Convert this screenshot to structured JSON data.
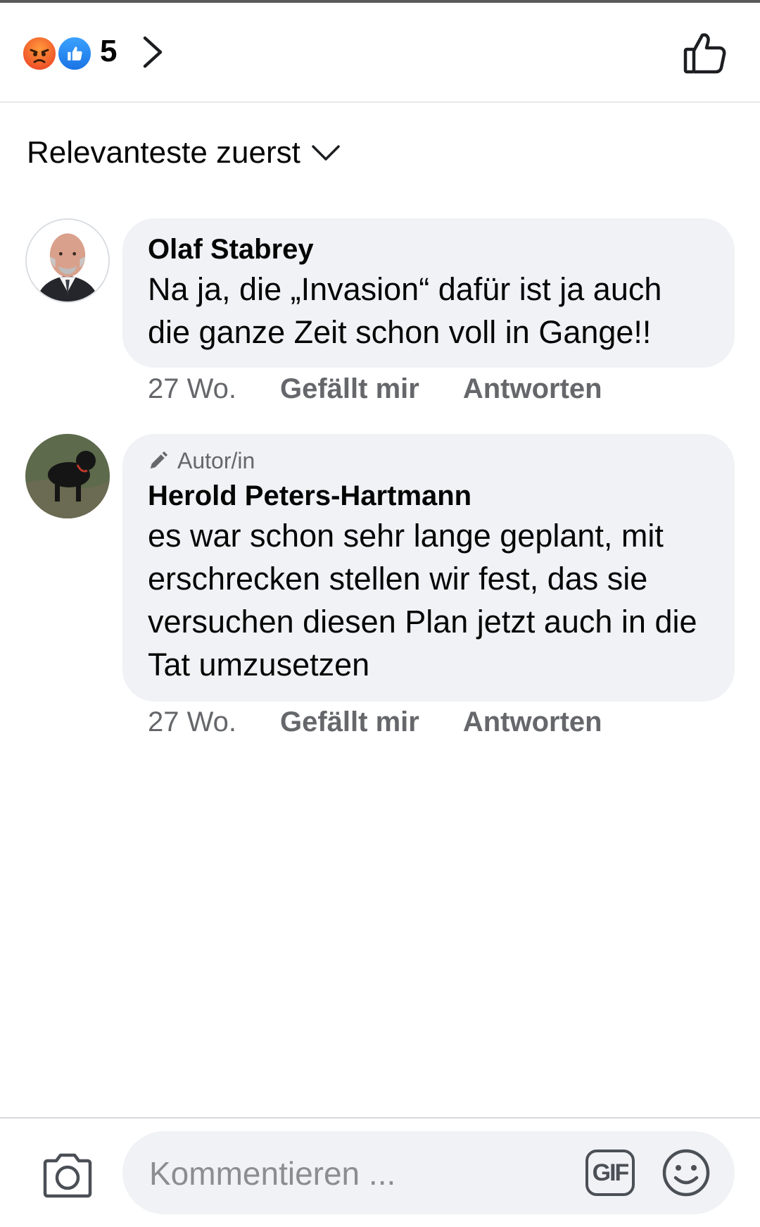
{
  "header": {
    "reactions": [
      "angry-reaction",
      "like-reaction"
    ],
    "reaction_count": "5"
  },
  "sort": {
    "label": "Relevanteste zuerst"
  },
  "comments": [
    {
      "author": "Olaf Stabrey",
      "text": "Na ja, die „Invasion“ dafür ist ja auch die ganze Zeit schon voll in Gange!!",
      "time": "27 Wo.",
      "like_label": "Gefällt mir",
      "reply_label": "Antworten"
    },
    {
      "badge": "Autor/in",
      "author": "Herold Peters-Hartmann",
      "text": "es war schon sehr lange geplant, mit erschrecken stellen wir fest, das sie versuchen diesen Plan jetzt auch in die Tat umzusetzen",
      "time": "27 Wo.",
      "like_label": "Gefällt mir",
      "reply_label": "Antworten"
    }
  ],
  "composer": {
    "placeholder": "Kommentieren ...",
    "gif_label": "GIF"
  },
  "colors": {
    "bubble": "#f0f2f5",
    "secondary_text": "#65676b",
    "like_blue": "#1b74e4",
    "angry_orange": "#f0562a"
  }
}
